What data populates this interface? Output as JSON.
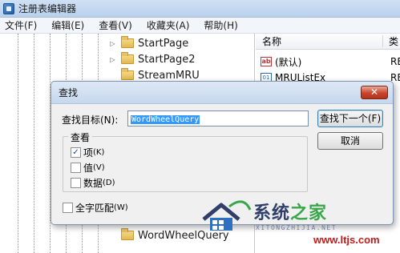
{
  "window": {
    "title": "注册表编辑器"
  },
  "menubar": {
    "items": [
      {
        "label": "文件(F)"
      },
      {
        "label": "编辑(E)"
      },
      {
        "label": "查看(V)"
      },
      {
        "label": "收藏夹(A)"
      },
      {
        "label": "帮助(H)"
      }
    ]
  },
  "tree": {
    "items": [
      {
        "label": "StartPage",
        "expander": "▷"
      },
      {
        "label": "StartPage2",
        "expander": "▷"
      },
      {
        "label": "StreamMRU",
        "expander": ""
      },
      {
        "label": "WordWheelQuery",
        "expander": ""
      }
    ]
  },
  "values": {
    "headers": {
      "name": "名称",
      "type": "类"
    },
    "rows": [
      {
        "name": "(默认)",
        "type": "RE",
        "icon": "string-value-icon"
      },
      {
        "name": "MRUListEx",
        "type": "RE",
        "icon": "binary-value-icon"
      }
    ]
  },
  "dialog": {
    "title": "查找",
    "close_glyph": "✕",
    "find_label": "查找目标(N):",
    "find_value": "WordWheelQuery",
    "find_next_label": "查找下一个(F)",
    "cancel_label": "取消",
    "look_at_legend": "查看",
    "options": [
      {
        "label": "项",
        "hotkey": "(K)",
        "checked": true
      },
      {
        "label": "值",
        "hotkey": "(V)",
        "checked": false
      },
      {
        "label": "数据",
        "hotkey": "(D)",
        "checked": false
      }
    ],
    "match_whole": {
      "label": "全字匹配",
      "hotkey": "(W)",
      "checked": false
    }
  },
  "watermark": {
    "brand_part1": "系统",
    "brand_part2": "之家",
    "pinyin": "XITONGZHIJIA.NET",
    "url": "www.ltjs.com",
    "accent_colors": {
      "blue": "#2f3f6a",
      "green": "#3aa64a",
      "red": "#c41a1a"
    }
  }
}
